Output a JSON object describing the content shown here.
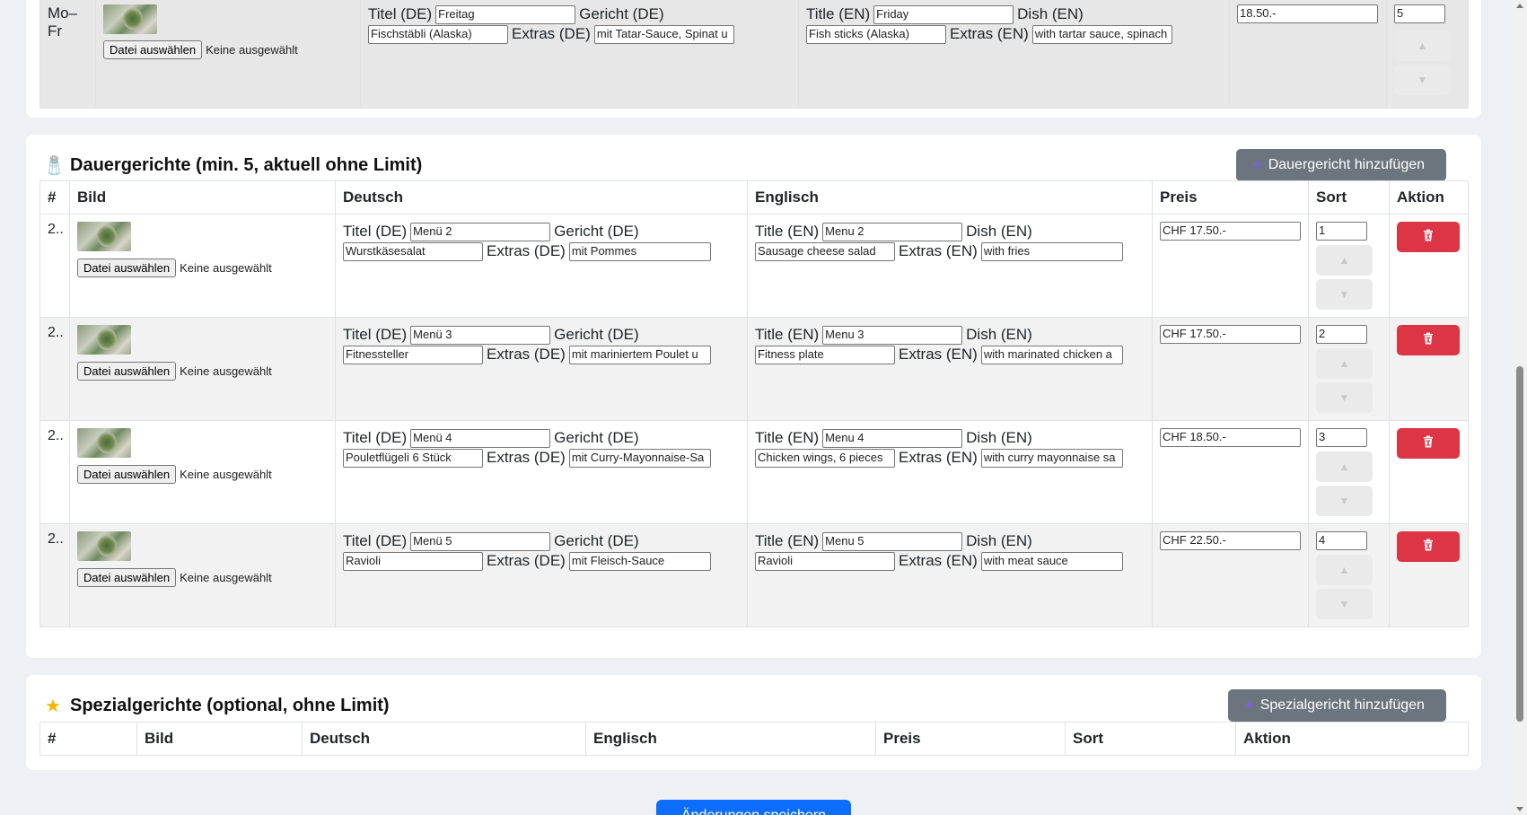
{
  "weekly": {
    "row": {
      "day": "Mo–Fr",
      "file_button": "Datei auswählen",
      "file_status": "Keine ausgewählt",
      "de_title_label": "Titel (DE)",
      "de_title": "Freitag",
      "de_dish_label": "Gericht (DE)",
      "de_dish": "Fischstäbli (Alaska)",
      "de_extras_label": "Extras (DE)",
      "de_extras": "mit Tatar-Sauce, Spinat u",
      "en_title_label": "Title (EN)",
      "en_title": "Friday",
      "en_dish_label": "Dish (EN)",
      "en_dish": "Fish sticks (Alaska)",
      "en_extras_label": "Extras (EN)",
      "en_extras": "with tartar sauce, spinach",
      "price": "18.50.-",
      "sort": "5"
    }
  },
  "permanent": {
    "title": "Dauergerichte (min. 5, aktuell ohne Limit)",
    "icon": "salt-shaker-icon",
    "add_button": "Dauergericht hinzufügen",
    "columns": [
      "#",
      "Bild",
      "Deutsch",
      "Englisch",
      "Preis",
      "Sort",
      "Aktion"
    ],
    "labels": {
      "de_title": "Titel (DE)",
      "de_dish": "Gericht (DE)",
      "de_extras": "Extras (DE)",
      "en_title": "Title (EN)",
      "en_dish": "Dish (EN)",
      "en_extras": "Extras (EN)",
      "file_button": "Datei auswählen",
      "file_status": "Keine ausgewählt"
    },
    "rows": [
      {
        "idx": "2..",
        "de_title": "Menü 2",
        "de_dish": "Wurstkäsesalat",
        "de_extras": "mit Pommes",
        "en_title": "Menu 2",
        "en_dish": "Sausage cheese salad",
        "en_extras": "with fries",
        "price": "CHF 17.50.-",
        "sort": "1"
      },
      {
        "idx": "2..",
        "de_title": "Menü 3",
        "de_dish": "Fitnessteller",
        "de_extras": "mit mariniertem Poulet u",
        "en_title": "Menu 3",
        "en_dish": "Fitness plate",
        "en_extras": "with marinated chicken a",
        "price": "CHF 17.50.-",
        "sort": "2"
      },
      {
        "idx": "2..",
        "de_title": "Menü 4",
        "de_dish": "Pouletflügeli 6 Stück",
        "de_extras": "mit Curry-Mayonnaise-Sa",
        "en_title": "Menu 4",
        "en_dish": "Chicken wings, 6 pieces",
        "en_extras": "with curry mayonnaise sa",
        "price": "CHF 18.50.-",
        "sort": "3"
      },
      {
        "idx": "2..",
        "de_title": "Menü 5",
        "de_dish": "Ravioli",
        "de_extras": "mit Fleisch-Sauce",
        "en_title": "Menu 5",
        "en_dish": "Ravioli",
        "en_extras": "with meat sauce",
        "price": "CHF 22.50.-",
        "sort": "4"
      }
    ]
  },
  "special": {
    "title": "Spezialgerichte (optional, ohne Limit)",
    "icon": "star-icon",
    "add_button": "Spezialgericht hinzufügen",
    "columns": [
      "#",
      "Bild",
      "Deutsch",
      "Englisch",
      "Preis",
      "Sort",
      "Aktion"
    ]
  },
  "save_button": "Änderungen speichern",
  "colors": {
    "primary": "#0d6efd",
    "danger": "#dc3545",
    "secondary": "#6c757d"
  }
}
